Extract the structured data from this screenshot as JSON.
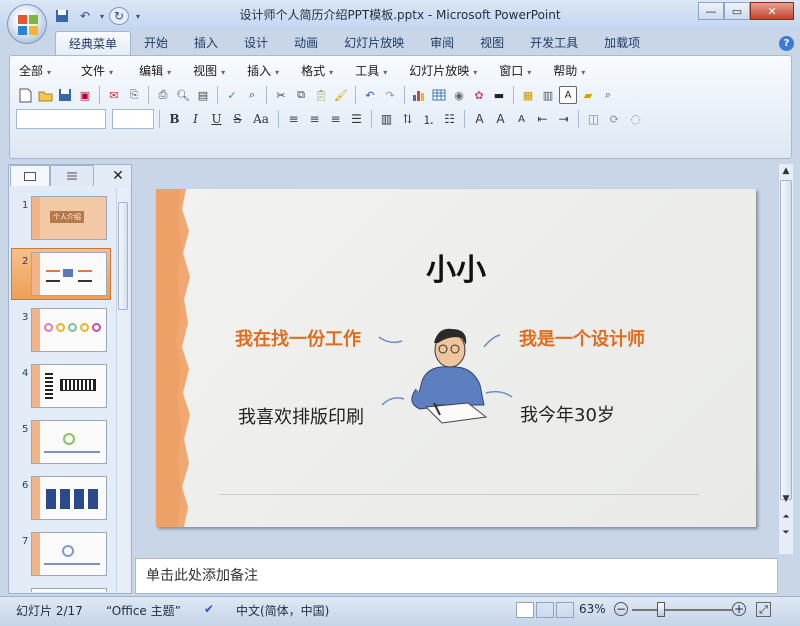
{
  "window": {
    "title": "设计师个人简历介绍PPT模板.pptx - Microsoft PowerPoint"
  },
  "tabs": [
    "经典菜单",
    "开始",
    "插入",
    "设计",
    "动画",
    "幻灯片放映",
    "审阅",
    "视图",
    "开发工具",
    "加载项"
  ],
  "menus": [
    "全部",
    "文件",
    "编辑",
    "视图",
    "插入",
    "格式",
    "工具",
    "幻灯片放映",
    "窗口",
    "帮助"
  ],
  "format": {
    "bold": "B",
    "italic": "I",
    "underline": "U",
    "strike": "S",
    "case": "Aa"
  },
  "slides": [
    {
      "num": "1",
      "title": "个人介绍"
    },
    {
      "num": "2"
    },
    {
      "num": "3"
    },
    {
      "num": "4"
    },
    {
      "num": "5"
    },
    {
      "num": "6"
    },
    {
      "num": "7"
    }
  ],
  "slide": {
    "title": "小小",
    "items": [
      "我在找一份工作",
      "我是一个设计师",
      "我喜欢排版印刷",
      "我今年30岁"
    ]
  },
  "colors": {
    "accent": "#e06c1e",
    "edge": "#f1a870"
  },
  "notes": {
    "placeholder": "单击此处添加备注"
  },
  "status": {
    "slide": "幻灯片 2/17",
    "theme": "“Office 主题”",
    "lang": "中文(简体，中国)",
    "zoom": "63%"
  }
}
